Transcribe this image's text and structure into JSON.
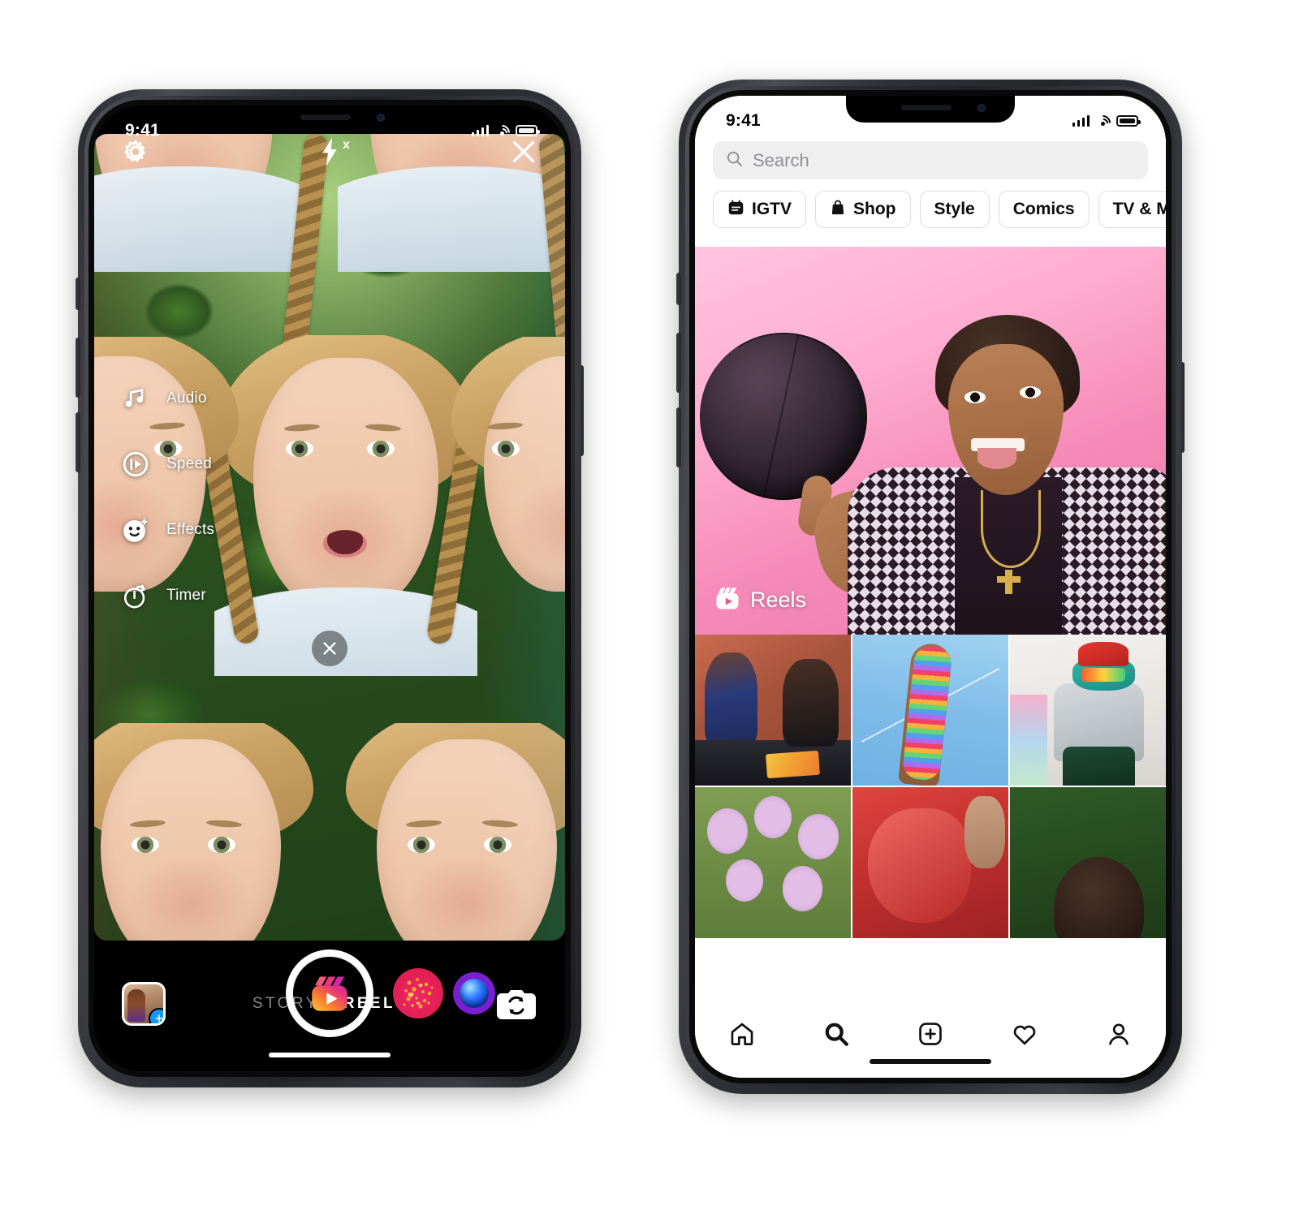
{
  "left_phone": {
    "status_bar": {
      "time": "9:41",
      "signal_icon": "cellular-signal-icon",
      "wifi_icon": "wifi-icon",
      "battery_icon": "battery-full-icon"
    },
    "camera": {
      "settings_icon": "gear-icon",
      "flash_icon": "flash-off-icon",
      "flash_badge": "x",
      "close_icon": "close-x-icon",
      "tools": [
        {
          "label": "Audio",
          "icon": "music-note-icon"
        },
        {
          "label": "Speed",
          "icon": "speed-play-icon"
        },
        {
          "label": "Effects",
          "icon": "effects-smiley-icon"
        },
        {
          "label": "Timer",
          "icon": "stopwatch-timer-icon"
        }
      ],
      "dismiss_effect_icon": "close-x-icon",
      "shutter": {
        "icon": "reels-clapperboard-icon",
        "label": "Record"
      },
      "effects": [
        {
          "name": "hearts-confetti-effect",
          "color": "#e8205a"
        },
        {
          "name": "blue-orb-effect",
          "color": "#7a1fd0"
        }
      ],
      "gallery_icon": "gallery-thumbnail",
      "gallery_add_badge": "+",
      "flip_camera_icon": "flip-camera-icon",
      "modes": [
        {
          "label": "STORY",
          "active": false
        },
        {
          "label": "REELS",
          "active": true
        }
      ]
    }
  },
  "right_phone": {
    "status_bar": {
      "time": "9:41",
      "signal_icon": "cellular-signal-icon",
      "wifi_icon": "wifi-icon",
      "battery_icon": "battery-full-icon"
    },
    "explore": {
      "search": {
        "placeholder": "Search",
        "value": "",
        "icon": "search-icon"
      },
      "chips": [
        {
          "label": "IGTV",
          "icon": "igtv-icon"
        },
        {
          "label": "Shop",
          "icon": "shopping-bag-icon"
        },
        {
          "label": "Style",
          "icon": ""
        },
        {
          "label": "Comics",
          "icon": ""
        },
        {
          "label": "TV & Movies",
          "icon": ""
        }
      ],
      "hero": {
        "badge_label": "Reels",
        "badge_icon": "reels-clapperboard-icon",
        "background_color": "#f7a8cb"
      },
      "grid_tiles": [
        "two-people-crafting-at-table",
        "hand-with-rainbow-rhinestone-nails",
        "person-in-red-beanie-and-denim-jacket",
        "purple-flowers-in-garden",
        "person-in-red-silk-fabric",
        "person-with-dark-hair-outdoors"
      ],
      "tabbar": [
        {
          "name": "home-icon",
          "active": false
        },
        {
          "name": "search-icon",
          "active": true
        },
        {
          "name": "add-post-icon",
          "active": false
        },
        {
          "name": "heart-icon",
          "active": false
        },
        {
          "name": "profile-icon",
          "active": false
        }
      ]
    }
  }
}
